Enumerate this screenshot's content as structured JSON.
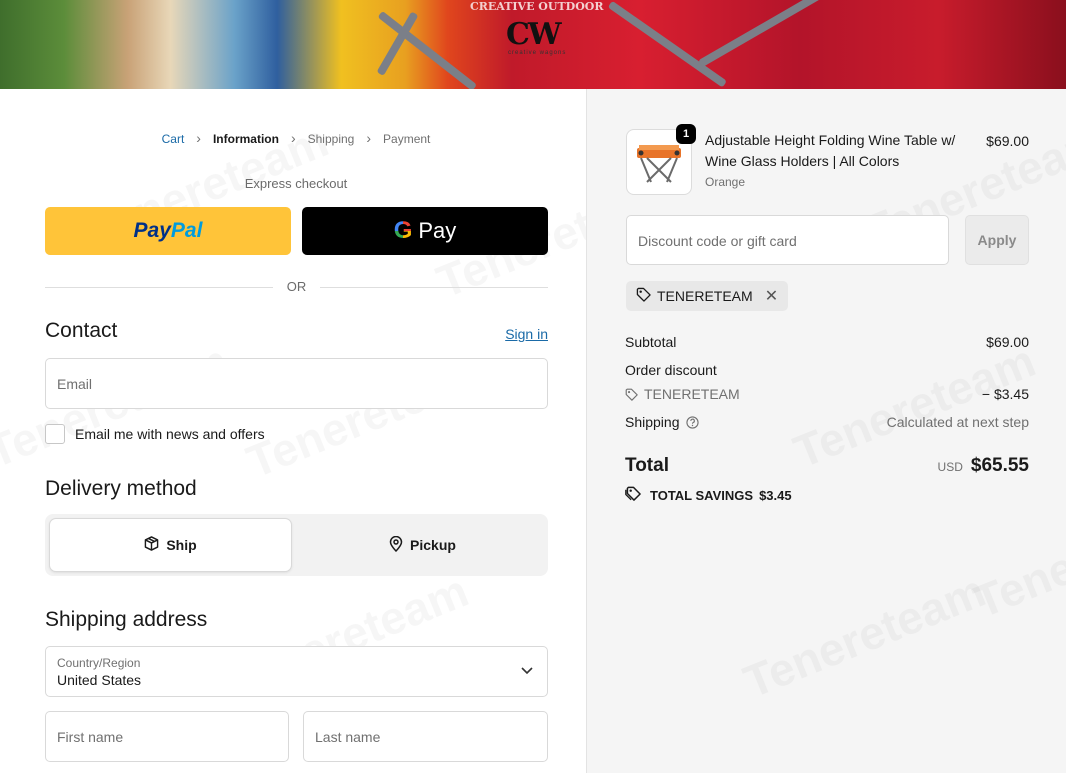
{
  "hero": {
    "logo": "CW",
    "brand_text": "CREATIVE OUTDOOR",
    "logo_sub": "creative wagons"
  },
  "breadcrumb": {
    "cart": "Cart",
    "information": "Information",
    "shipping": "Shipping",
    "payment": "Payment"
  },
  "express": {
    "title": "Express checkout",
    "paypal_1": "Pay",
    "paypal_2": "Pal",
    "gpay_g": "G",
    "gpay_text": "Pay",
    "or": "OR"
  },
  "contact": {
    "title": "Contact",
    "sign_in": "Sign in",
    "email_placeholder": "Email",
    "newsletter": "Email me with news and offers"
  },
  "delivery": {
    "title": "Delivery method",
    "ship": "Ship",
    "pickup": "Pickup",
    "selected": "Ship"
  },
  "shipping_address": {
    "title": "Shipping address",
    "country_label": "Country/Region",
    "country_value": "United States",
    "first_name_placeholder": "First name",
    "last_name_placeholder": "Last name"
  },
  "order": {
    "item": {
      "quantity": "1",
      "name": "Adjustable Height Folding Wine Table w/ Wine Glass Holders | All Colors",
      "variant": "Orange",
      "price": "$69.00"
    },
    "discount_placeholder": "Discount code or gift card",
    "apply": "Apply",
    "applied_code": "TENERETEAM",
    "subtotal_label": "Subtotal",
    "subtotal_value": "$69.00",
    "order_discount_label": "Order discount",
    "discount_code": "TENERETEAM",
    "discount_value": "− $3.45",
    "shipping_label": "Shipping",
    "shipping_value": "Calculated at next step",
    "total_label": "Total",
    "currency": "USD",
    "total_value": "$65.55",
    "savings_label": "TOTAL SAVINGS",
    "savings_value": "$3.45"
  },
  "watermark": "Tenereteam",
  "colors": {
    "link": "#1a6aa7",
    "paypal_yellow": "#ffc439",
    "gpay_black": "#000000",
    "summary_bg": "#f5f5f5"
  }
}
